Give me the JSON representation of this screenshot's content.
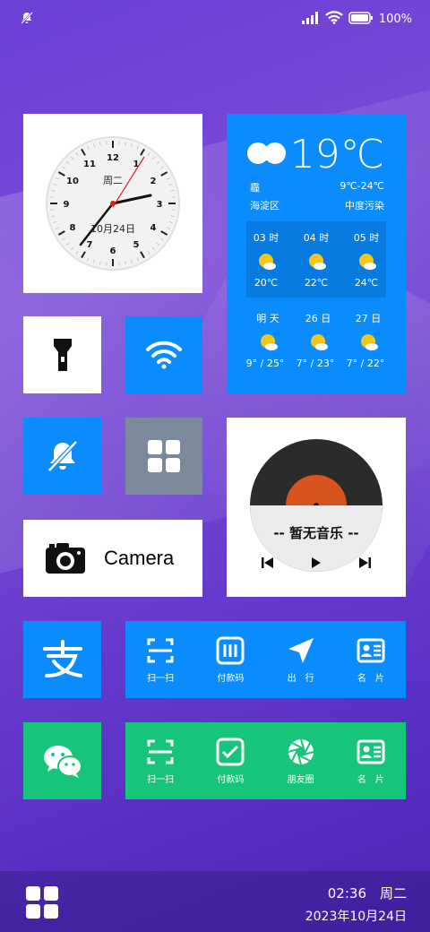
{
  "status": {
    "battery": "100%"
  },
  "clock": {
    "weekday": "周二",
    "date": "10月24日",
    "numbers": [
      "12",
      "1",
      "2",
      "3",
      "4",
      "5",
      "6",
      "7",
      "8",
      "9",
      "10",
      "11"
    ]
  },
  "weather": {
    "temp": "19℃",
    "condition": "霾",
    "range": "9℃-24℃",
    "district": "海淀区",
    "pollution": "中度污染",
    "hourly": [
      {
        "time": "03 时",
        "temp": "20℃"
      },
      {
        "time": "04 时",
        "temp": "22℃"
      },
      {
        "time": "05 时",
        "temp": "24℃"
      }
    ],
    "daily": [
      {
        "day": "明 天",
        "range": "9° / 25°"
      },
      {
        "day": "26 日",
        "range": "7° / 23°"
      },
      {
        "day": "27 日",
        "range": "7° / 22°"
      }
    ]
  },
  "music": {
    "status": "-- 暂无音乐 --"
  },
  "camera": {
    "label": "Camera"
  },
  "alipay": {
    "actions": [
      "扫一扫",
      "付款码",
      "出　行",
      "名　片"
    ]
  },
  "wechat": {
    "actions": [
      "扫一扫",
      "付款码",
      "朋友圈",
      "名　片"
    ]
  },
  "dock": {
    "time": "02:36　周二",
    "date": "2023年10月24日"
  },
  "colors": {
    "blue": "#0a8cff",
    "green": "#16c47a",
    "gray": "#7a8a9a",
    "record_center": "#d9531e"
  }
}
